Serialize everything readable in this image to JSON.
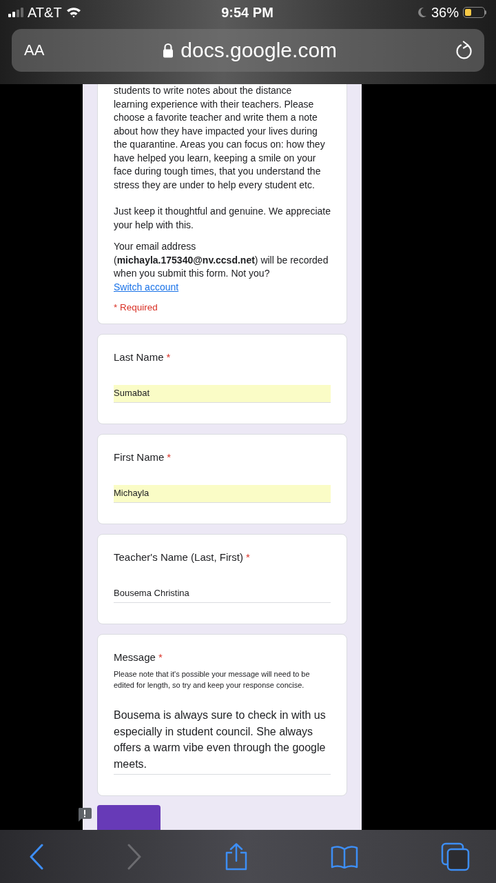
{
  "status_bar": {
    "carrier": "AT&T",
    "time": "9:54 PM",
    "battery": "36%"
  },
  "address_bar": {
    "text_size_button": "AA",
    "url": "docs.google.com"
  },
  "form": {
    "intro_cut_line": "students to write notes about the distance",
    "description": "learning experience with their teachers. Please choose a favorite teacher and write them a note about how they have impacted your lives during the quarantine. Areas you can focus on: how they have helped you learn, keeping a smile on your face during tough times, that you understand the stress they are under to help every student etc.",
    "closing": "Just keep it thoughtful and genuine. We appreciate your help with this.",
    "email_notice": "Your email address (**michayla.175340@nv.ccsd.net**) will be recorded when you submit this form. Not you?",
    "switch_link": "Switch account",
    "required_note": "* Required",
    "questions": [
      {
        "kind": "short",
        "title": "Last Name",
        "required_mark": "*",
        "value": "Sumabat",
        "autofilled": true
      },
      {
        "kind": "short",
        "title": "First Name",
        "required_mark": "*",
        "value": "Michayla",
        "autofilled": true
      },
      {
        "kind": "short",
        "title": "Teacher's Name (Last, First)",
        "required_mark": "*",
        "value": "Bousema Christina",
        "autofilled": false
      },
      {
        "kind": "paragraph",
        "title": "Message",
        "required_mark": "*",
        "help": "Please note that it's possible your message will need to be edited for length, so try and keep your response concise.",
        "value": "Bousema is always sure to check in with us especially in student council. She always offers a warm vibe even through the google meets.",
        "autofilled": false
      }
    ]
  }
}
